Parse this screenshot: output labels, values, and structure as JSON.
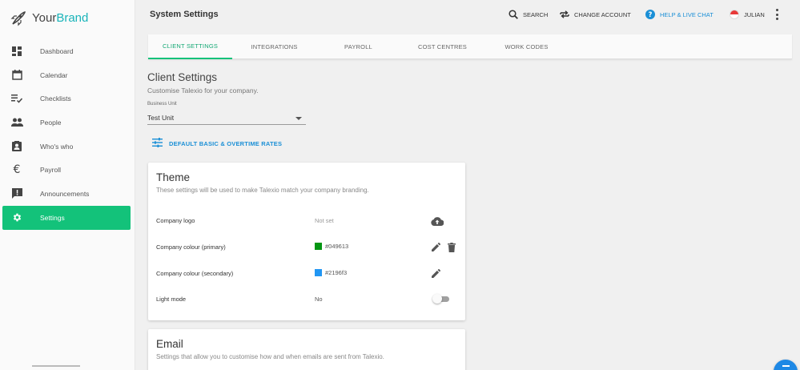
{
  "brand": {
    "name_plain": "Your",
    "name_accent": "Brand",
    "accent_color": "#19b4b9"
  },
  "sidebar": {
    "items": [
      {
        "label": "Dashboard",
        "icon": "dashboard-icon"
      },
      {
        "label": "Calendar",
        "icon": "calendar-icon"
      },
      {
        "label": "Checklists",
        "icon": "checklist-icon"
      },
      {
        "label": "People",
        "icon": "people-icon"
      },
      {
        "label": "Who's who",
        "icon": "contact-card-icon"
      },
      {
        "label": "Payroll",
        "icon": "euro-icon"
      },
      {
        "label": "Announcements",
        "icon": "announcement-icon"
      },
      {
        "label": "Settings",
        "icon": "gear-icon",
        "active": true
      }
    ],
    "active_color": "#13c27a"
  },
  "header": {
    "title": "System Settings",
    "search_label": "SEARCH",
    "change_account_label": "CHANGE ACCOUNT",
    "help_label": "HELP & LIVE CHAT",
    "user_name": "JULIAN"
  },
  "tabs": [
    {
      "label": "CLIENT SETTINGS",
      "active": true
    },
    {
      "label": "INTEGRATIONS"
    },
    {
      "label": "PAYROLL"
    },
    {
      "label": "COST CENTRES"
    },
    {
      "label": "WORK CODES"
    }
  ],
  "client_settings": {
    "title": "Client Settings",
    "subtitle": "Customise Talexio for your company.",
    "business_unit_label": "Business Unit",
    "business_unit_value": "Test Unit",
    "rates_button_label": "DEFAULT BASIC & OVERTIME RATES"
  },
  "theme_card": {
    "title": "Theme",
    "subtitle": "These settings will be used to make Talexio match your company branding.",
    "rows": {
      "logo": {
        "label": "Company logo",
        "value": "Not set"
      },
      "primary": {
        "label": "Company colour (primary)",
        "value": "#049613",
        "swatch": "#049613"
      },
      "secondary": {
        "label": "Company colour (secondary)",
        "value": "#2196f3",
        "swatch": "#2196f3"
      },
      "light_mode": {
        "label": "Light mode",
        "value": "No"
      }
    }
  },
  "email_card": {
    "title": "Email",
    "subtitle": "Settings that allow you to customise how and when emails are sent from Talexio."
  }
}
